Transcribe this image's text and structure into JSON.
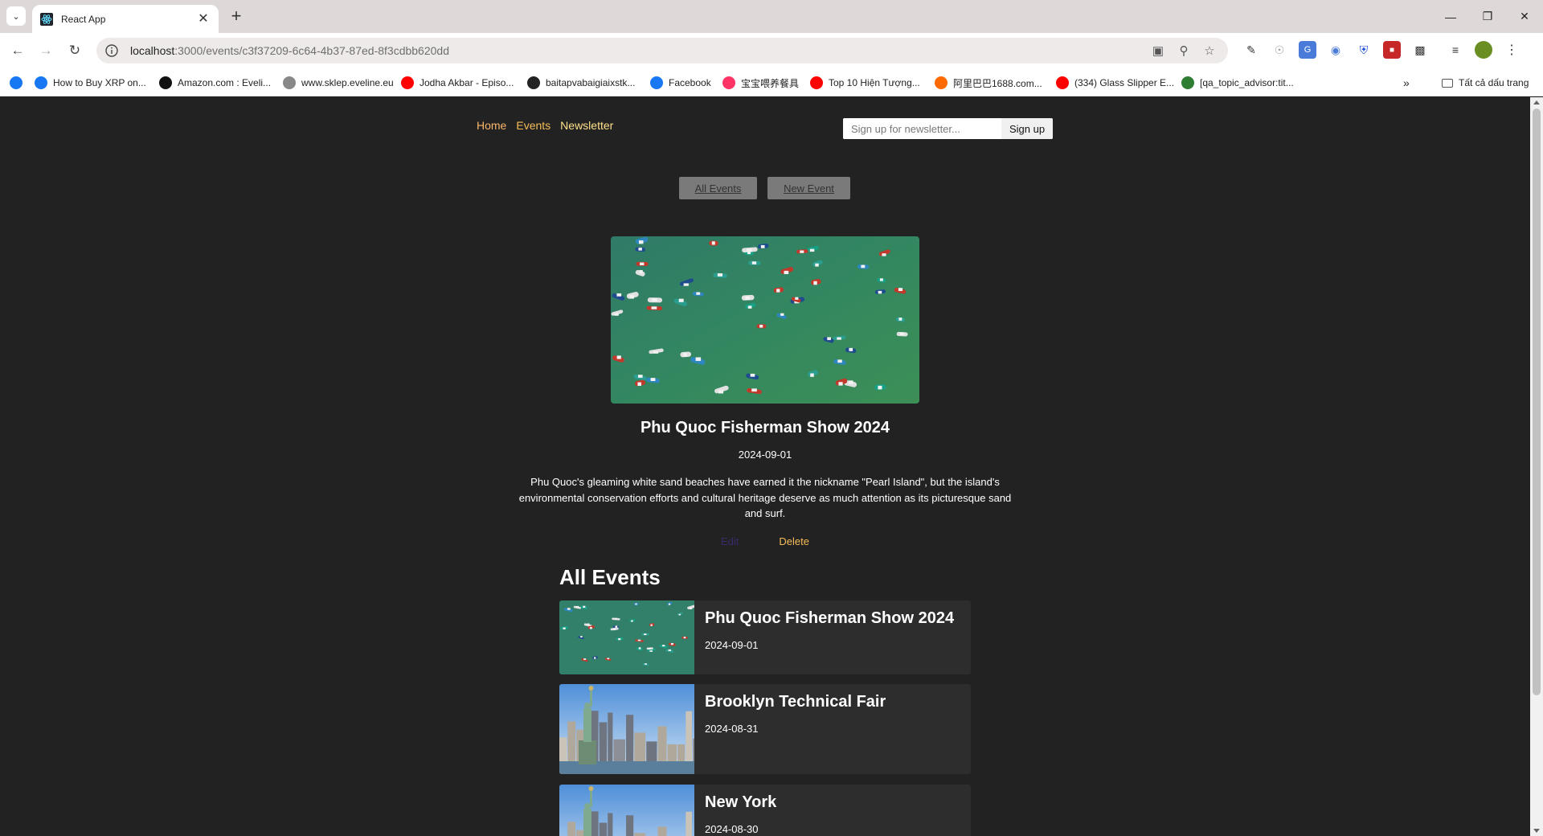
{
  "browser": {
    "tab_title": "React App",
    "url_host": "localhost",
    "url_path": ":3000/events/c3f37209-6c64-4b37-87ed-8f3cdbb620dd",
    "bookmarks": [
      {
        "label": "",
        "icon": "facebook-icon",
        "color": "#1877f2"
      },
      {
        "label": "How to Buy XRP on...",
        "icon": "xrp-icon",
        "color": "#1877f2"
      },
      {
        "label": "Amazon.com : Eveli...",
        "icon": "amazon-icon",
        "color": "#111111"
      },
      {
        "label": "www.sklep.eveline.eu",
        "icon": "eveline-icon",
        "color": "#888888"
      },
      {
        "label": "Jodha Akbar - Episo...",
        "icon": "youtube-icon",
        "color": "#ff0000"
      },
      {
        "label": "baitapvabaigiaixstk...",
        "icon": "globe-icon",
        "color": "#222222"
      },
      {
        "label": "Facebook",
        "icon": "facebook-icon",
        "color": "#1877f2"
      },
      {
        "label": "宝宝喂养餐具",
        "icon": "shop-icon",
        "color": "#ff3366"
      },
      {
        "label": "Top 10 Hiện Tượng...",
        "icon": "youtube-icon",
        "color": "#ff0000"
      },
      {
        "label": "阿里巴巴1688.com...",
        "icon": "alibaba-icon",
        "color": "#ff6a00"
      },
      {
        "label": "(334) Glass Slipper E...",
        "icon": "youtube-icon",
        "color": "#ff0000"
      },
      {
        "label": "[qa_topic_advisor:tit...",
        "icon": "qa-icon",
        "color": "#2e7d32"
      }
    ],
    "all_bookmarks_label": "Tất cả dấu trang"
  },
  "nav": {
    "home": "Home",
    "events": "Events",
    "newsletter": "Newsletter",
    "newsletter_placeholder": "Sign up for newsletter...",
    "signup_label": "Sign up"
  },
  "subnav": {
    "all_events": "All Events",
    "new_event": "New Event"
  },
  "event_detail": {
    "title": "Phu Quoc Fisherman Show 2024",
    "date": "2024-09-01",
    "description": "Phu Quoc's gleaming white sand beaches have earned it the nickname \"Pearl Island\", but the island's environmental conservation efforts and cultural heritage deserve as much attention as its picturesque sand and surf.",
    "edit_label": "Edit",
    "delete_label": "Delete"
  },
  "events_list": {
    "heading": "All Events",
    "items": [
      {
        "title": "Phu Quoc Fisherman Show 2024",
        "date": "2024-09-01",
        "image": "boats"
      },
      {
        "title": "Brooklyn Technical Fair",
        "date": "2024-08-31",
        "image": "liberty"
      },
      {
        "title": "New York",
        "date": "2024-08-30",
        "image": "liberty"
      }
    ]
  }
}
